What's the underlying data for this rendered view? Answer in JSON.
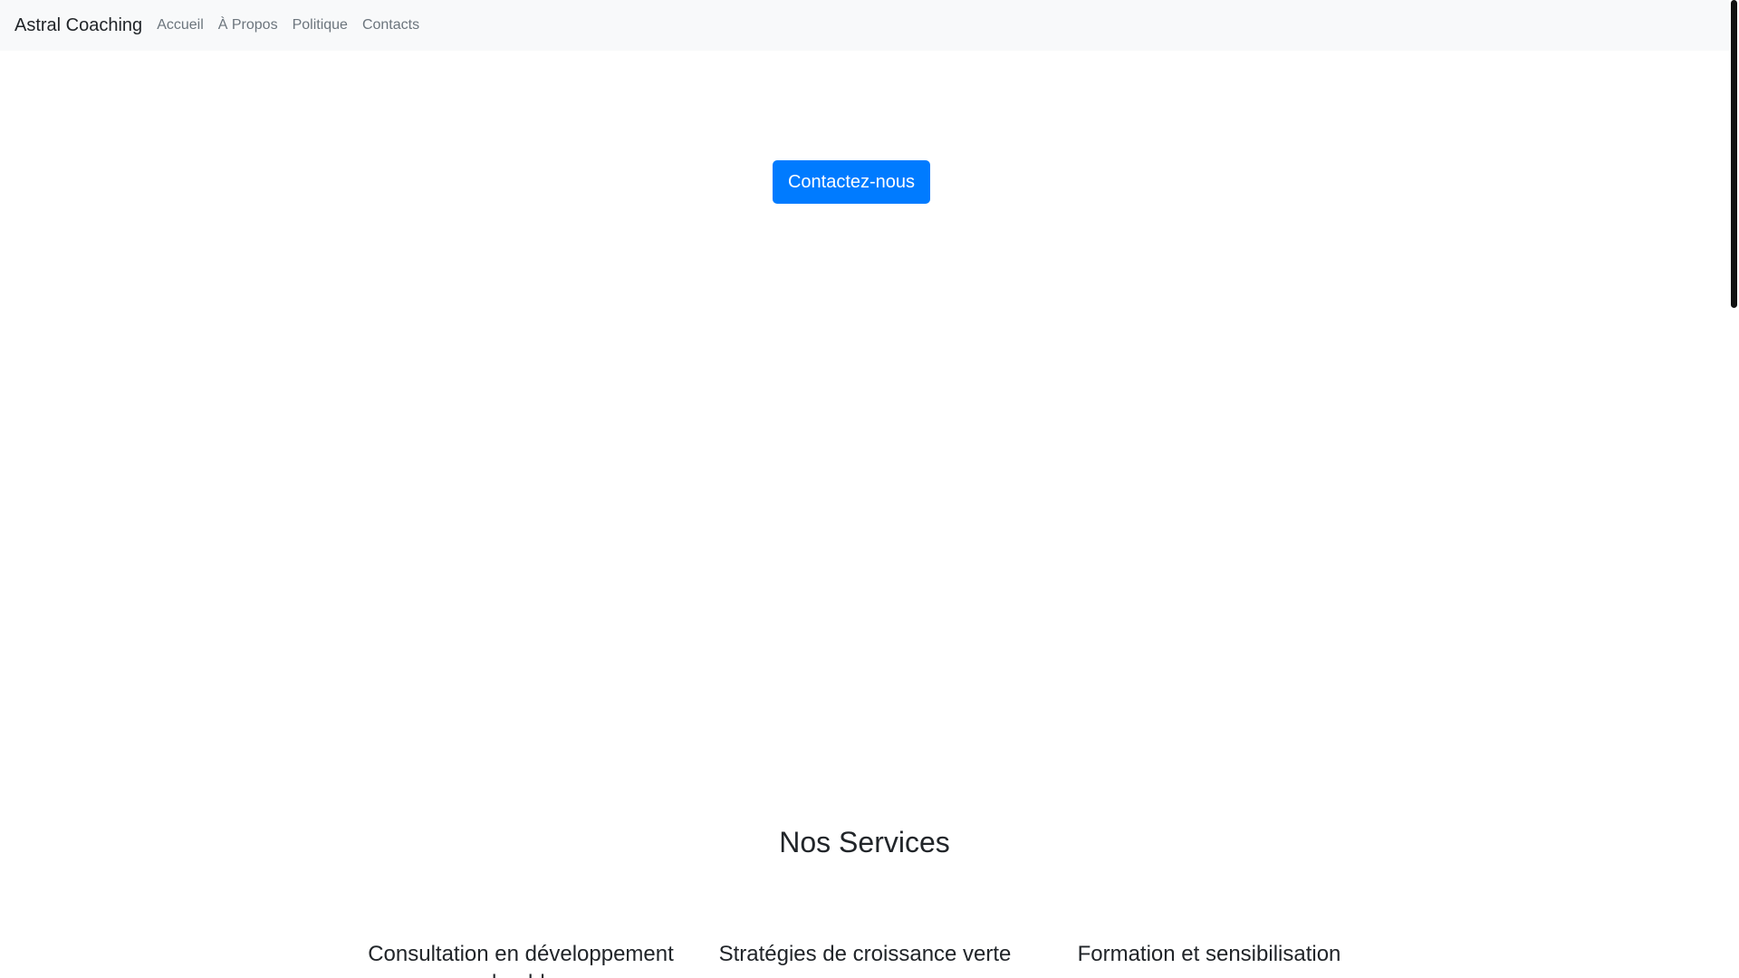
{
  "navbar": {
    "brand": "Astral Coaching",
    "links": [
      "Accueil",
      "À Propos",
      "Politique",
      "Contacts"
    ]
  },
  "hero": {
    "cta_label": "Contactez-nous"
  },
  "services": {
    "title": "Nos Services",
    "items": [
      "Consultation en développement durable",
      "Stratégies de croissance verte",
      "Formation et sensibilisation"
    ]
  },
  "colors": {
    "navbar_bg": "#f8f9fa",
    "primary": "#007bff",
    "link_muted": "#6c757d"
  }
}
